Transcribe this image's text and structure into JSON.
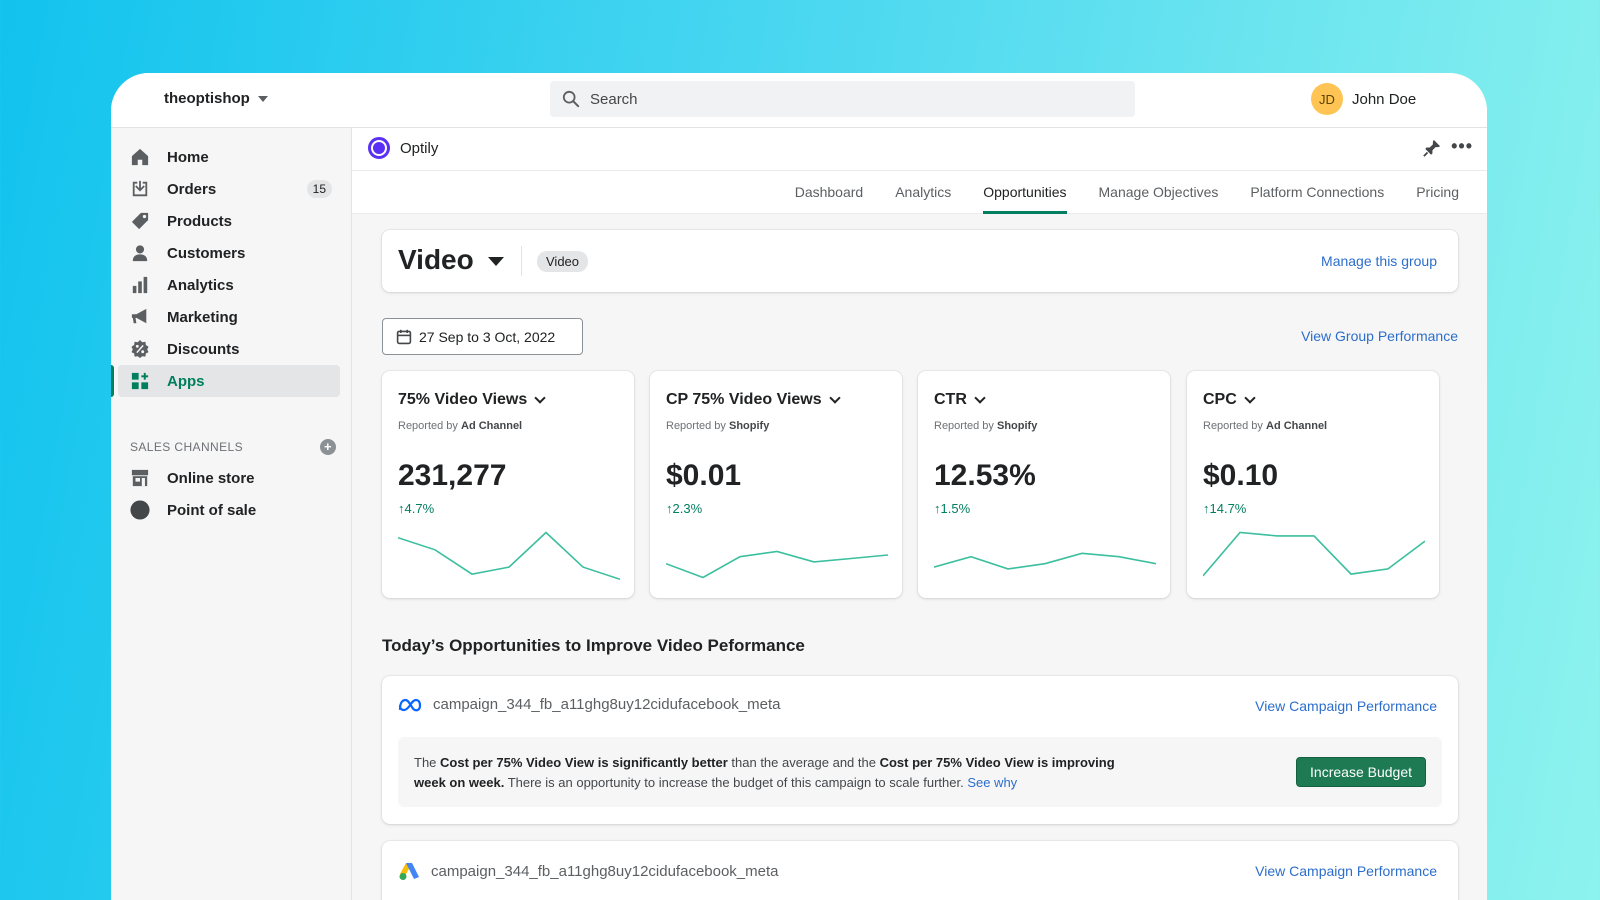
{
  "topbar": {
    "store_name": "theoptishop",
    "search_placeholder": "Search",
    "user_initials": "JD",
    "user_name": "John Doe"
  },
  "sidebar": {
    "items": [
      {
        "label": "Home",
        "icon": "home-icon"
      },
      {
        "label": "Orders",
        "icon": "orders-icon",
        "badge": "15"
      },
      {
        "label": "Products",
        "icon": "tag-icon"
      },
      {
        "label": "Customers",
        "icon": "person-icon"
      },
      {
        "label": "Analytics",
        "icon": "bar-chart-icon"
      },
      {
        "label": "Marketing",
        "icon": "megaphone-icon"
      },
      {
        "label": "Discounts",
        "icon": "discount-icon"
      },
      {
        "label": "Apps",
        "icon": "apps-icon",
        "active": true
      }
    ],
    "channels_heading": "SALES CHANNELS",
    "channels": [
      {
        "label": "Online store",
        "icon": "store-icon"
      },
      {
        "label": "Point of sale",
        "icon": "pos-icon"
      }
    ]
  },
  "app": {
    "name": "Optily",
    "tabs": [
      "Dashboard",
      "Analytics",
      "Opportunities",
      "Manage Objectives",
      "Platform Connections",
      "Pricing"
    ],
    "active_tab": "Opportunities"
  },
  "group": {
    "title": "Video",
    "tag": "Video",
    "manage_link": "Manage this group"
  },
  "date_range": "27 Sep to 3 Oct, 2022",
  "view_group_link": "View Group Performance",
  "metrics": [
    {
      "title": "75% Video Views",
      "reported_prefix": "Reported by",
      "reported_by": "Ad Channel",
      "value": "231,277",
      "change": "4.7%",
      "trend": [
        25,
        18,
        4,
        8,
        28,
        8,
        1
      ]
    },
    {
      "title": "CP 75% Video Views",
      "reported_prefix": "Reported by",
      "reported_by": "Shopify",
      "value": "$0.01",
      "change": "2.3%",
      "trend": [
        10,
        2,
        14,
        17,
        11,
        13,
        15
      ]
    },
    {
      "title": "CTR",
      "reported_prefix": "Reported by",
      "reported_by": "Shopify",
      "value": "12.53%",
      "change": "1.5%",
      "trend": [
        8,
        14,
        7,
        10,
        16,
        14,
        10
      ]
    },
    {
      "title": "CPC",
      "reported_prefix": "Reported by",
      "reported_by": "Ad Channel",
      "value": "$0.10",
      "change": "14.7%",
      "trend": [
        3,
        28,
        26,
        26,
        4,
        7,
        23
      ]
    }
  ],
  "opportunities": {
    "heading": "Today’s Opportunities to Improve Video Peformance",
    "items": [
      {
        "campaign": "campaign_344_fb_a11ghg8uy12cidufacebook_meta",
        "link": "View Campaign Performance",
        "text": {
          "t1": "The ",
          "b1": "Cost per 75% Video View is significantly better",
          "t2": " than the average and the ",
          "b2": "Cost per 75% Video View is improving week on week.",
          "t3": " There is an opportunity to increase the budget of this campaign to scale further. ",
          "see_why": "See why"
        },
        "action": "Increase Budget",
        "icon": "meta-logo-icon"
      },
      {
        "campaign": "campaign_344_fb_a11ghg8uy12cidufacebook_meta",
        "link": "View Campaign Performance",
        "icon": "google-ads-logo-icon"
      }
    ]
  },
  "colors": {
    "accent": "#008060",
    "link": "#2c6ecb",
    "spark": "#3bbf9e",
    "brand_purple": "#5a31f4"
  }
}
